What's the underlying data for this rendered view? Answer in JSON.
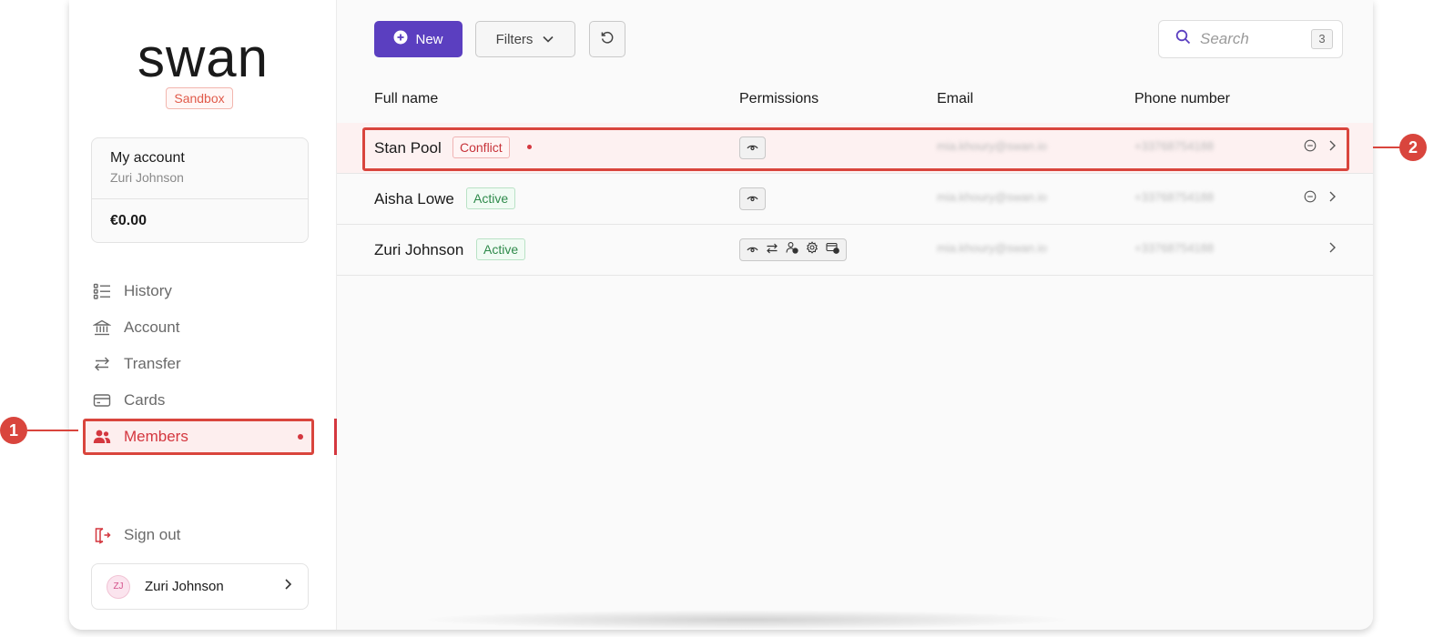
{
  "brand": {
    "logo": "swan",
    "env_badge": "Sandbox"
  },
  "account_card": {
    "title": "My account",
    "owner": "Zuri Johnson",
    "balance": "€0.00"
  },
  "nav": {
    "items": [
      {
        "label": "History",
        "icon": "list-icon"
      },
      {
        "label": "Account",
        "icon": "bank-icon"
      },
      {
        "label": "Transfer",
        "icon": "transfer-icon"
      },
      {
        "label": "Cards",
        "icon": "card-icon"
      },
      {
        "label": "Members",
        "icon": "users-icon",
        "active": true
      }
    ],
    "sign_out": "Sign out"
  },
  "user": {
    "initials": "ZJ",
    "name": "Zuri Johnson"
  },
  "toolbar": {
    "new_label": "New",
    "filters_label": "Filters",
    "search_placeholder": "Search",
    "search_count": "3"
  },
  "table": {
    "headers": {
      "name": "Full name",
      "permissions": "Permissions",
      "email": "Email",
      "phone": "Phone number"
    },
    "rows": [
      {
        "name": "Stan Pool",
        "status": "Conflict",
        "email": "mia.khoury@swan.io",
        "phone": "+33768754188"
      },
      {
        "name": "Aisha Lowe",
        "status": "Active",
        "email": "mia.khoury@swan.io",
        "phone": "+33768754188"
      },
      {
        "name": "Zuri Johnson",
        "status": "Active",
        "email": "mia.khoury@swan.io",
        "phone": "+33768754188"
      }
    ]
  },
  "callouts": {
    "one": "1",
    "two": "2"
  },
  "colors": {
    "accent": "#5b3fc0",
    "danger": "#d9453d",
    "active_nav": "#d4373f",
    "success": "#2f8a4b"
  }
}
